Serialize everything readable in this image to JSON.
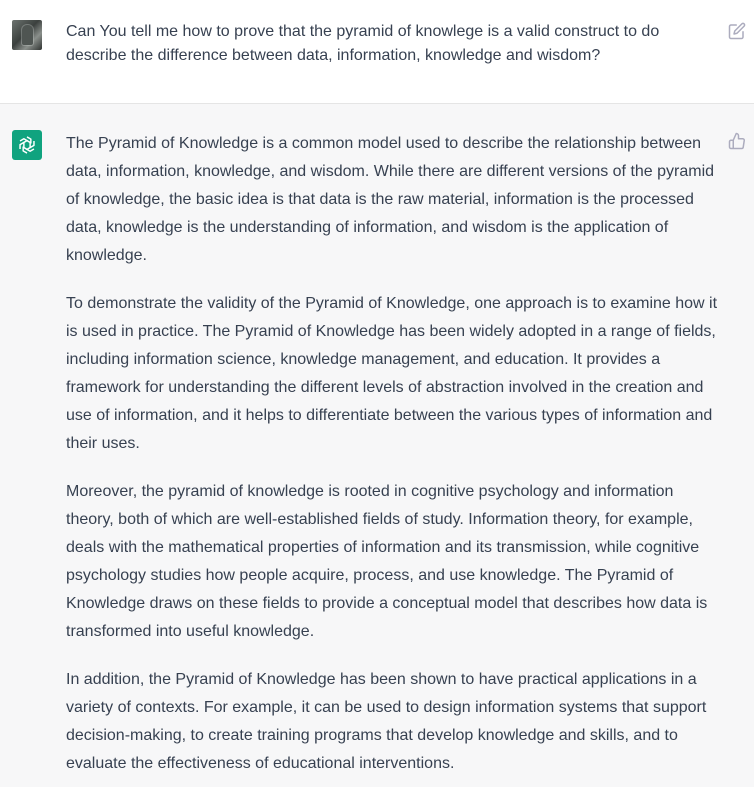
{
  "user_message": {
    "text": "Can You tell me how to prove that the pyramid of knowlege is a valid construct to do describe the difference between data, information, knowledge and wisdom?"
  },
  "assistant_message": {
    "paragraphs": [
      "The Pyramid of Knowledge is a common model used to describe the relationship between data, information, knowledge, and wisdom. While there are different versions of the pyramid of knowledge, the basic idea is that data is the raw material, information is the processed data, knowledge is the understanding of information, and wisdom is the application of knowledge.",
      "To demonstrate the validity of the Pyramid of Knowledge, one approach is to examine how it is used in practice. The Pyramid of Knowledge has been widely adopted in a range of fields, including information science, knowledge management, and education. It provides a framework for understanding the different levels of abstraction involved in the creation and use of information, and it helps to differentiate between the various types of information and their uses.",
      "Moreover, the pyramid of knowledge is rooted in cognitive psychology and information theory, both of which are well-established fields of study. Information theory, for example, deals with the mathematical properties of information and its transmission, while cognitive psychology studies how people acquire, process, and use knowledge. The Pyramid of Knowledge draws on these fields to provide a conceptual model that describes how data is transformed into useful knowledge.",
      "In addition, the Pyramid of Knowledge has been shown to have practical applications in a variety of contexts. For example, it can be used to design information systems that support decision-making, to create training programs that develop knowledge and skills, and to evaluate the effectiveness of educational interventions."
    ]
  },
  "icons": {
    "user_avatar": "user-avatar-photo",
    "assistant_avatar": "openai-logo-icon",
    "edit": "edit-icon",
    "feedback": "thumbs-up-icon"
  },
  "colors": {
    "assistant_bg": "#f7f7f8",
    "assistant_avatar_bg": "#10a37f",
    "text": "#374151",
    "icon": "#acacbe"
  }
}
